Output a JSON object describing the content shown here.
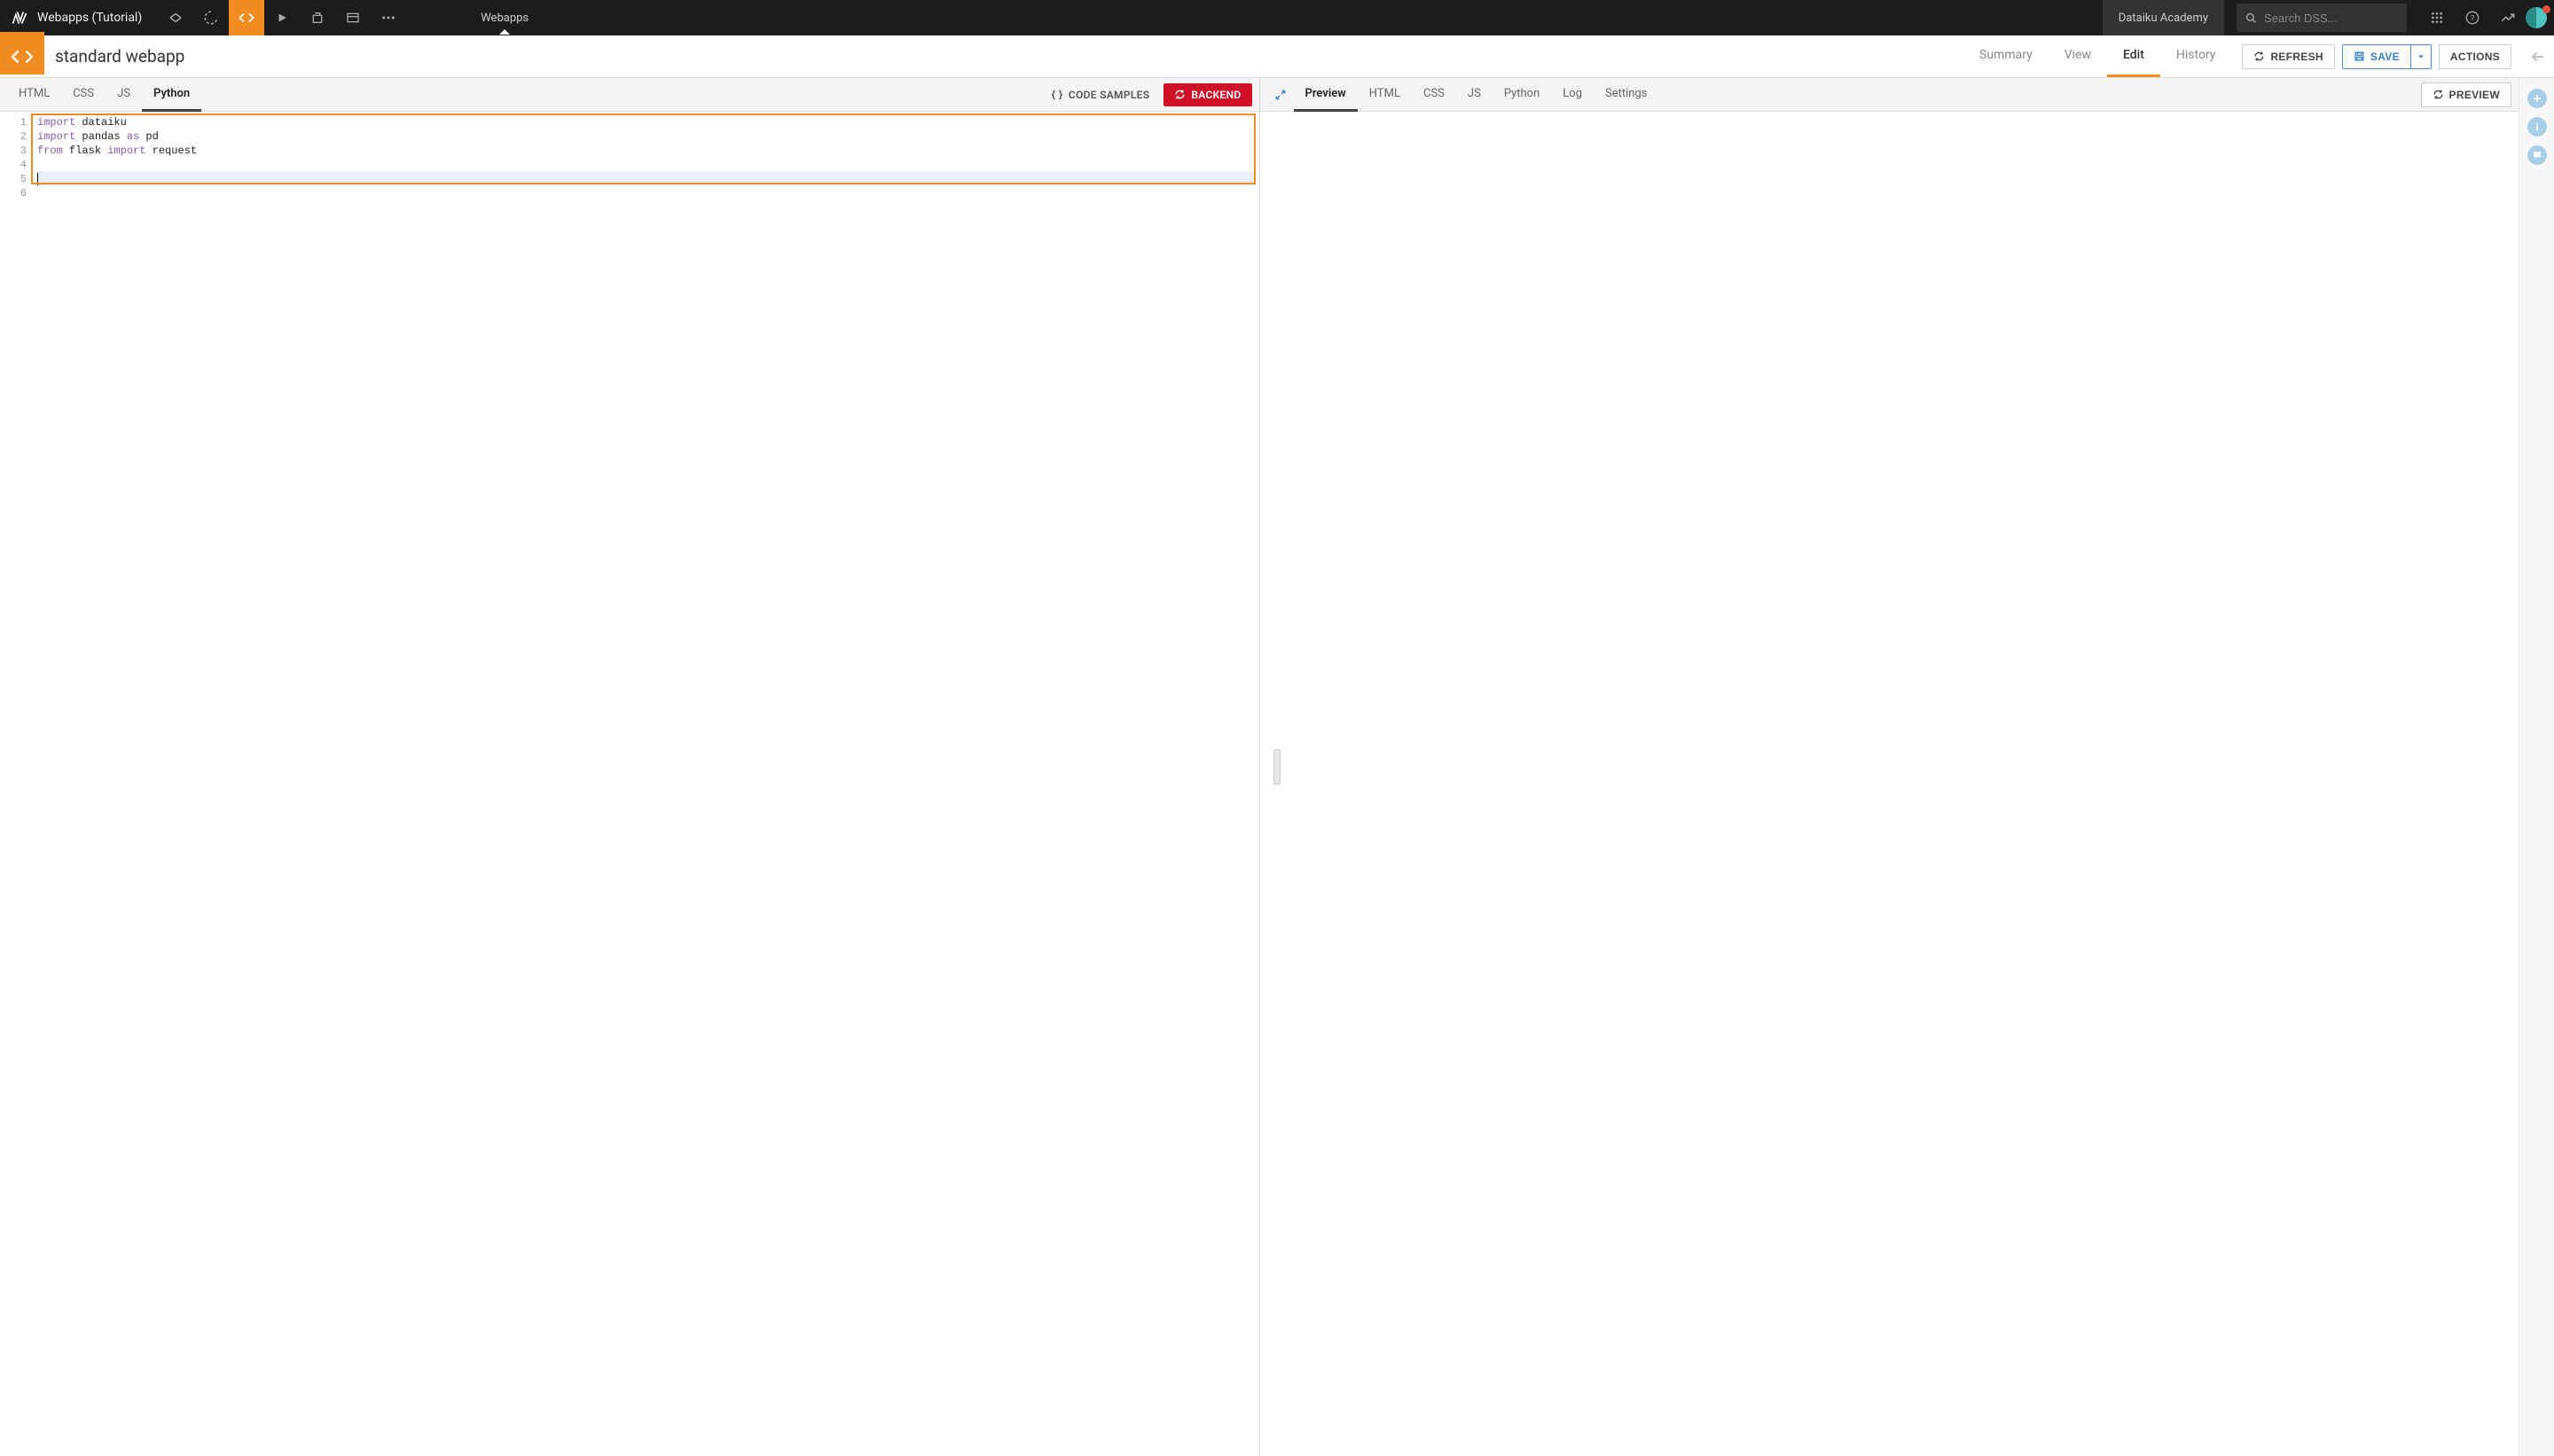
{
  "topnav": {
    "project_name": "Webapps (Tutorial)",
    "breadcrumb_current": "Webapps",
    "academy_label": "Dataiku Academy",
    "search_placeholder": "Search DSS..."
  },
  "object_header": {
    "title": "standard webapp",
    "tabs": [
      "Summary",
      "View",
      "Edit",
      "History"
    ],
    "active_tab": "Edit",
    "refresh_label": "REFRESH",
    "save_label": "SAVE",
    "actions_label": "ACTIONS"
  },
  "left_panel": {
    "tabs": [
      "HTML",
      "CSS",
      "JS",
      "Python"
    ],
    "active_tab": "Python",
    "code_samples_label": "CODE SAMPLES",
    "backend_label": "BACKEND",
    "code_lines": [
      {
        "n": 1,
        "tokens": [
          {
            "t": "import",
            "c": "kw"
          },
          {
            "t": " dataiku",
            "c": "nm"
          }
        ]
      },
      {
        "n": 2,
        "tokens": [
          {
            "t": "import",
            "c": "kw"
          },
          {
            "t": " pandas ",
            "c": "nm"
          },
          {
            "t": "as",
            "c": "kw"
          },
          {
            "t": " pd",
            "c": "nm"
          }
        ]
      },
      {
        "n": 3,
        "tokens": [
          {
            "t": "from",
            "c": "kw"
          },
          {
            "t": " flask ",
            "c": "nm"
          },
          {
            "t": "import",
            "c": "kw"
          },
          {
            "t": " request",
            "c": "nm"
          }
        ]
      },
      {
        "n": 4,
        "tokens": []
      },
      {
        "n": 5,
        "tokens": [],
        "active": true,
        "cursor": true
      },
      {
        "n": 6,
        "tokens": []
      }
    ]
  },
  "right_panel": {
    "tabs": [
      "Preview",
      "HTML",
      "CSS",
      "JS",
      "Python",
      "Log",
      "Settings"
    ],
    "active_tab": "Preview",
    "preview_label": "PREVIEW"
  }
}
